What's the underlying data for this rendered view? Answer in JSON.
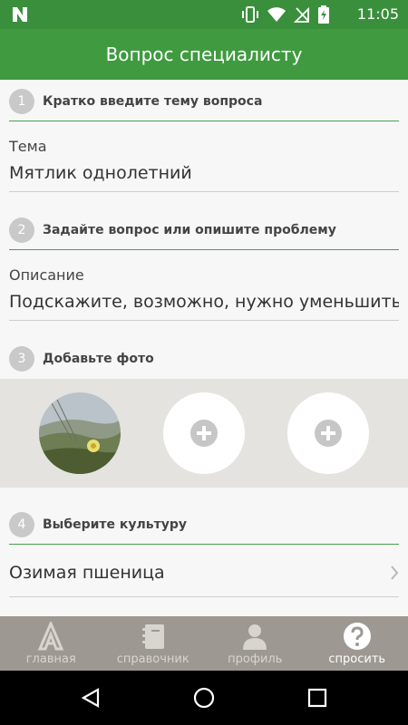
{
  "status_bar": {
    "time": "11:05"
  },
  "app_bar": {
    "title": "Вопрос специалисту"
  },
  "sections": {
    "topic": {
      "number": "1",
      "title": "Кратко введите тему вопроса",
      "field_label": "Тема",
      "field_value": "Мятлик однолетний"
    },
    "question": {
      "number": "2",
      "title": "Задайте вопрос или опишите проблему",
      "field_label": "Описание",
      "field_value": "Подскажите, возможно, нужно уменьшить"
    },
    "photo": {
      "number": "3",
      "title": "Добавьте фото"
    },
    "culture": {
      "number": "4",
      "title": "Выберите культуру",
      "selected": "Озимая пшеница"
    }
  },
  "bottom_nav": {
    "items": [
      {
        "label": "главная",
        "icon": "home-logo-icon"
      },
      {
        "label": "справочник",
        "icon": "notebook-icon"
      },
      {
        "label": "профиль",
        "icon": "person-icon"
      },
      {
        "label": "спросить",
        "icon": "question-icon"
      }
    ],
    "active_index": 3
  },
  "colors": {
    "primary": "#3f9a40",
    "status_bar": "#3a8f3c",
    "nav_bg": "#9e9893",
    "section_line": "#4c9c4e"
  }
}
